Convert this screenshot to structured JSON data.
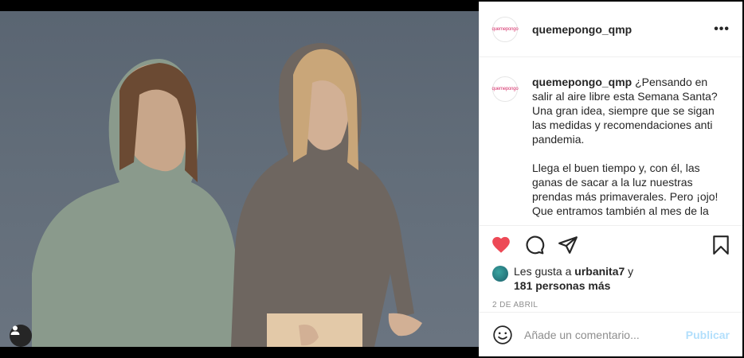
{
  "post": {
    "username": "quemepongo_qmp",
    "avatar_text": "quemepongo",
    "more_icon": "more-horizontal-icon",
    "caption": {
      "username": "quemepongo_qmp",
      "paragraph1": "¿Pensando en salir al aire libre esta Semana Santa? Una gran idea, siempre que se sigan las medidas y recomendaciones anti pandemia.",
      "paragraph2": "Llega el buen tiempo y, con él, las ganas de sacar a la luz nuestras prendas más primaverales. Pero ¡ojo! Que entramos también al mes de la"
    },
    "likes": {
      "prefix": "Les gusta a ",
      "first_user": "urbanita7",
      "middle": " y",
      "others": "181 personas más"
    },
    "date": "2 DE ABRIL",
    "liked": true,
    "colors": {
      "heart": "#ed4956",
      "publish": "#b2dffc",
      "meta": "#8e8e8e"
    }
  },
  "comment": {
    "placeholder": "Añade un comentario...",
    "publish_label": "Publicar"
  }
}
